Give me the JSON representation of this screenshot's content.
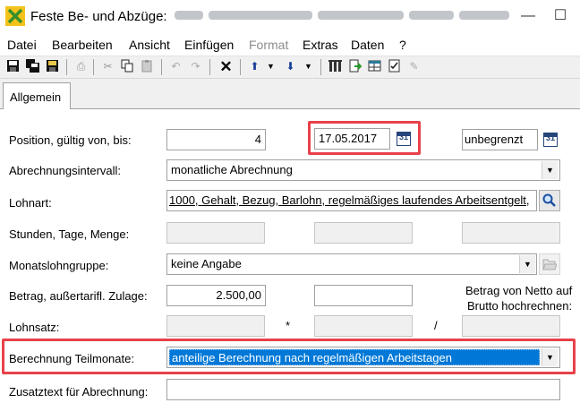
{
  "window": {
    "title": "Feste Be- und Abzüge:",
    "controls": {
      "minimize": "—",
      "maximize": "☐",
      "close": "✕"
    }
  },
  "menu": [
    "Datei",
    "Bearbeiten",
    "Ansicht",
    "Einfügen",
    "Format",
    "Extras",
    "Daten",
    "?"
  ],
  "tabs": [
    "Allgemein"
  ],
  "form": {
    "position_label": "Position, gültig von, bis:",
    "position_value": "4",
    "valid_from": "17.05.2017",
    "valid_to": "unbegrenzt",
    "calendar_glyph": "31",
    "interval_label": "Abrechnungsintervall:",
    "interval_value": "monatliche Abrechnung",
    "lohnart_label": "Lohnart:",
    "lohnart_value": "1000, Gehalt, Bezug, Barlohn, regelmäßiges laufendes Arbeitsentgelt,",
    "quantity_label": "Stunden, Tage, Menge:",
    "wage_group_label": "Monatslohngruppe:",
    "wage_group_value": "keine Angabe",
    "amount_label": "Betrag, außertarifl. Zulage:",
    "amount_value": "2.500,00",
    "net_gross_line1": "Betrag von Netto auf",
    "net_gross_line2": "Brutto hochrechnen:",
    "rate_label": "Lohnsatz:",
    "multiply_sign": "*",
    "divide_sign": "/",
    "partial_label": "Berechnung Teilmonate:",
    "partial_value": "anteilige Berechnung nach regelmäßigen Arbeitstagen",
    "extra_text_label": "Zusatztext für Abrechnung:",
    "extra_text_value": ""
  },
  "colors": {
    "highlight": "#e8414a",
    "selection": "#0078d7",
    "toolbar": "#f0f0f0"
  }
}
